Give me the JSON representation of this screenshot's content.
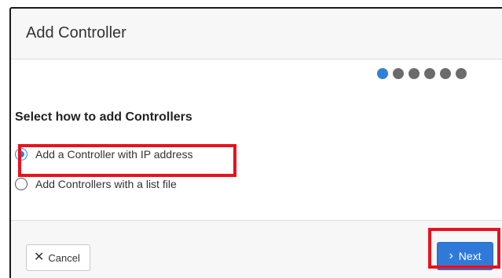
{
  "dialog": {
    "title": "Add Controller"
  },
  "steps": {
    "total": 6,
    "current": 1
  },
  "section": {
    "title": "Select how to add Controllers"
  },
  "options": [
    {
      "label": "Add a Controller with IP address",
      "selected": true
    },
    {
      "label": "Add Controllers with a list file",
      "selected": false
    }
  ],
  "footer": {
    "cancel_label": "Cancel",
    "cancel_icon": "close-icon",
    "next_label": "Next",
    "next_icon": "chevron-right-icon"
  },
  "colors": {
    "accent": "#2f80d8",
    "highlight": "#e8121d"
  }
}
